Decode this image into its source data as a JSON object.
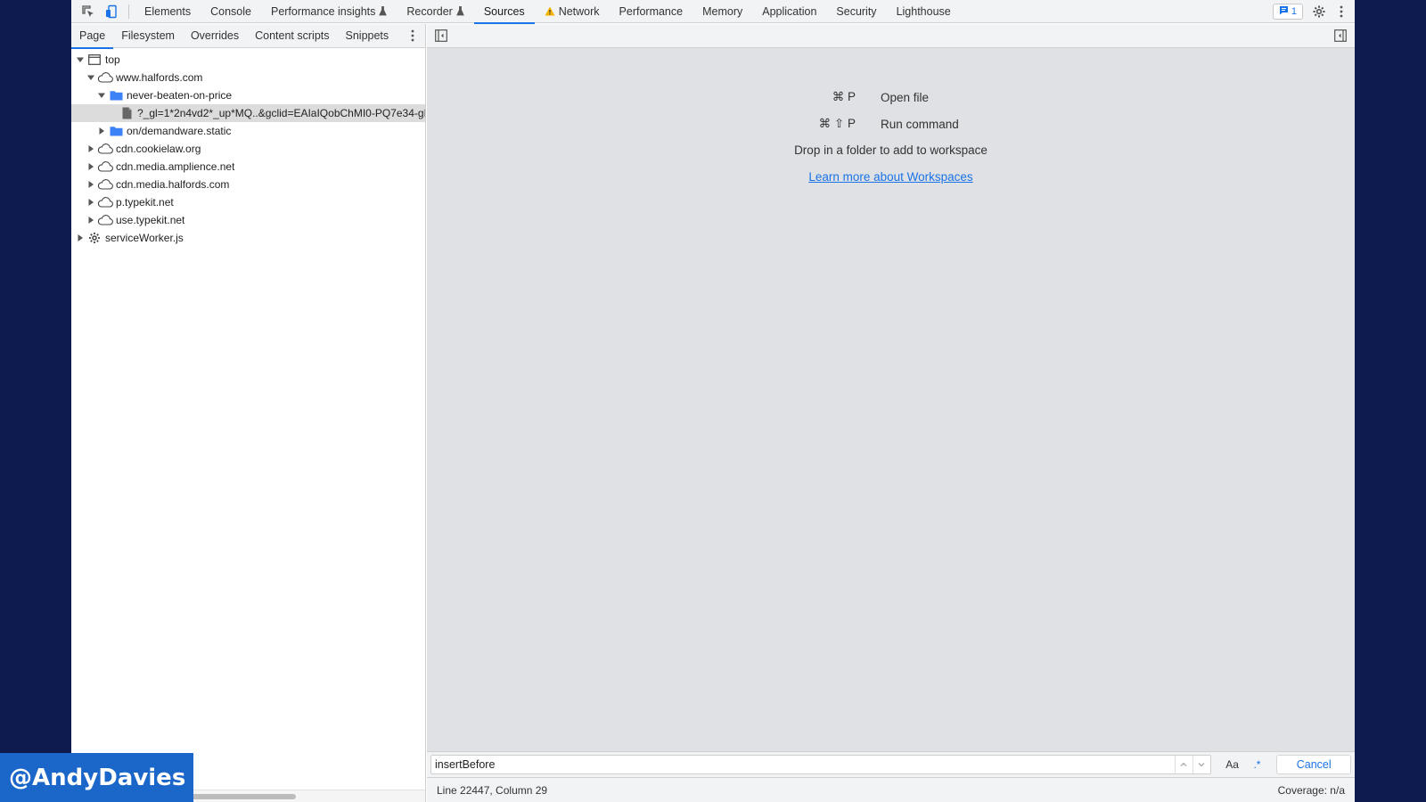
{
  "main_tabs": [
    {
      "label": "Elements",
      "icon": ""
    },
    {
      "label": "Console",
      "icon": ""
    },
    {
      "label": "Performance insights",
      "icon": "flask-icon"
    },
    {
      "label": "Recorder",
      "icon": "flask-icon"
    },
    {
      "label": "Sources",
      "icon": "",
      "active": true
    },
    {
      "label": "Network",
      "icon": "warning-icon"
    },
    {
      "label": "Performance",
      "icon": ""
    },
    {
      "label": "Memory",
      "icon": ""
    },
    {
      "label": "Application",
      "icon": ""
    },
    {
      "label": "Security",
      "icon": ""
    },
    {
      "label": "Lighthouse",
      "icon": ""
    }
  ],
  "toolbar": {
    "issues_count": "1"
  },
  "navigator": {
    "tabs": [
      "Page",
      "Filesystem",
      "Overrides",
      "Content scripts",
      "Snippets"
    ],
    "active_tab": "Page",
    "tree": [
      {
        "label": "top",
        "level": 0,
        "expanded": true,
        "icon": "frame-icon"
      },
      {
        "label": "www.halfords.com",
        "level": 1,
        "expanded": true,
        "icon": "cloud-icon"
      },
      {
        "label": "never-beaten-on-price",
        "level": 2,
        "expanded": true,
        "icon": "folder-icon"
      },
      {
        "label": "?_gl=1*2n4vd2*_up*MQ..&gclid=EAIaIQobChMI0-PQ7e34-gI",
        "level": 3,
        "icon": "file-icon",
        "selected": true
      },
      {
        "label": "on/demandware.static",
        "level": 2,
        "expanded": false,
        "icon": "folder-icon"
      },
      {
        "label": "cdn.cookielaw.org",
        "level": 1,
        "expanded": false,
        "icon": "cloud-icon"
      },
      {
        "label": "cdn.media.amplience.net",
        "level": 1,
        "expanded": false,
        "icon": "cloud-icon"
      },
      {
        "label": "cdn.media.halfords.com",
        "level": 1,
        "expanded": false,
        "icon": "cloud-icon"
      },
      {
        "label": "p.typekit.net",
        "level": 1,
        "expanded": false,
        "icon": "cloud-icon"
      },
      {
        "label": "use.typekit.net",
        "level": 1,
        "expanded": false,
        "icon": "cloud-icon"
      },
      {
        "label": "serviceWorker.js",
        "level": 0,
        "expanded": false,
        "icon": "gear-icon"
      }
    ]
  },
  "editor": {
    "shortcuts": [
      {
        "keys": "⌘ P",
        "action": "Open file"
      },
      {
        "keys": "⌘ ⇧ P",
        "action": "Run command"
      }
    ],
    "drop_text": "Drop in a folder to add to workspace",
    "learn_link": "Learn more about Workspaces"
  },
  "search": {
    "value": "insertBefore",
    "match_case_label": "Aa",
    "regex_label": ".*",
    "cancel_label": "Cancel"
  },
  "status": {
    "position": "Line 22447, Column 29",
    "coverage": "Coverage: n/a"
  },
  "watermark": "@AndyDavies",
  "colors": {
    "accent": "#1a73e8",
    "folder": "#3b82f6",
    "warning": "#f4b400",
    "watermark_bg": "#1b66c9",
    "page_bg": "#0d1b4f"
  }
}
